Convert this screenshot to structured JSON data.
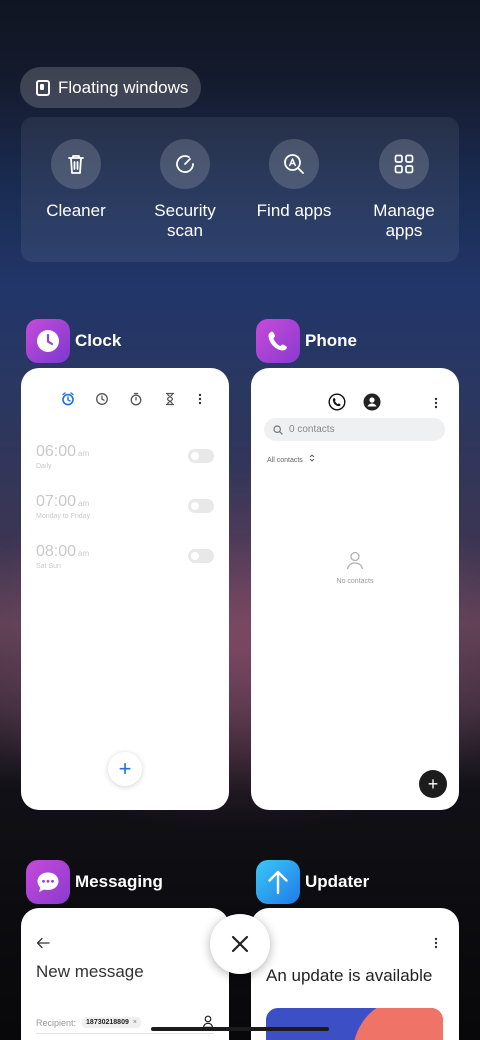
{
  "floating_windows": {
    "label": "Floating windows",
    "icon": "floating-window-icon"
  },
  "tools": [
    {
      "label": "Cleaner",
      "icon": "trash-icon"
    },
    {
      "label": "Security\nscan",
      "icon": "security-scan-icon"
    },
    {
      "label": "Find apps",
      "icon": "find-apps-icon"
    },
    {
      "label": "Manage\napps",
      "icon": "grid-icon"
    }
  ],
  "apps": {
    "clock": {
      "name": "Clock",
      "accent": "#1f6fe5",
      "alarms": [
        {
          "time": "06:00",
          "ampm": "am",
          "repeat": "Daily"
        },
        {
          "time": "07:00",
          "ampm": "am",
          "repeat": "Monday to Friday"
        },
        {
          "time": "08:00",
          "ampm": "am",
          "repeat": "Sat Sun"
        }
      ],
      "fab": "+"
    },
    "phone": {
      "name": "Phone",
      "search_placeholder": "0 contacts",
      "filter": "All contacts",
      "empty": "No contacts",
      "fab": "+"
    },
    "messaging": {
      "name": "Messaging",
      "title": "New message",
      "recipient_label": "Recipient:",
      "recipient_chip": "18730218809",
      "chip_close": "×"
    },
    "updater": {
      "name": "Updater",
      "title": "An update is available"
    }
  },
  "close_label": "close-all"
}
